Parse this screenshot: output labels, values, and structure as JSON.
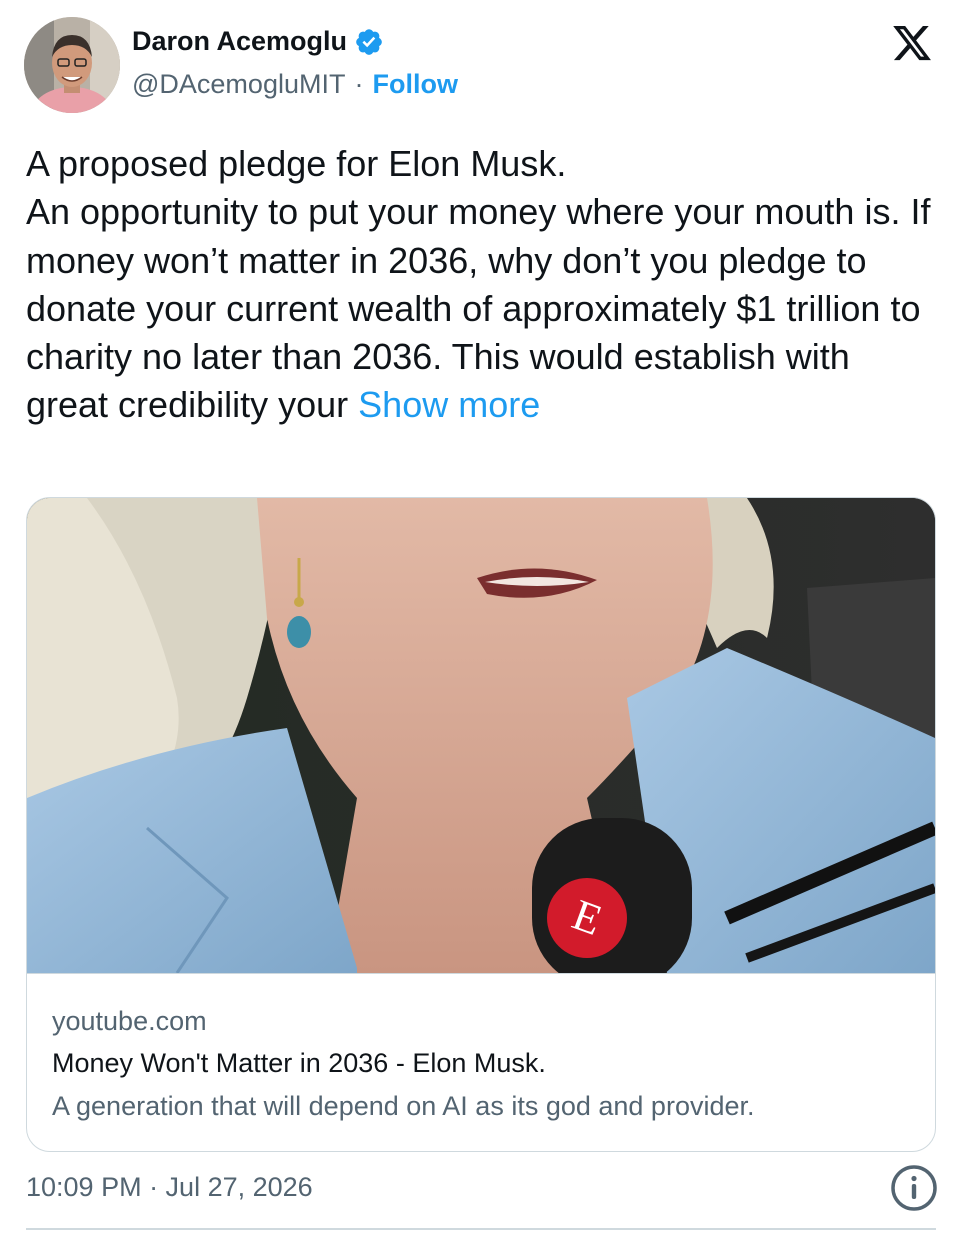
{
  "author": {
    "name": "Daron Acemoglu",
    "handle": "@DAcemogluMIT",
    "separator": "·",
    "follow_label": "Follow",
    "verified_color": "#1d9bf0"
  },
  "tweet": {
    "lines": [
      "A proposed pledge for Elon Musk.",
      "An opportunity to put your money where your mouth is. If money won’t matter in 2036, why don’t you pledge to donate your current wealth of approximately $1 trillion to charity no later than 2036. This would establish with great credibility your"
    ],
    "show_more_label": "Show more"
  },
  "card": {
    "domain": "youtube.com",
    "title": "Money Won't Matter in 2036 - Elon Musk.",
    "description": "A generation that will depend on AI as its god and provider.",
    "mic_letter": "E"
  },
  "footer": {
    "timestamp": "10:09 PM · Jul 27, 2026"
  },
  "icons": {
    "verified": "verified-badge-icon",
    "platform": "x-logo-icon",
    "info": "info-icon"
  },
  "colors": {
    "accent": "#1d9bf0",
    "text": "#0f1419",
    "secondary": "#536471",
    "border": "#cfd9de"
  }
}
